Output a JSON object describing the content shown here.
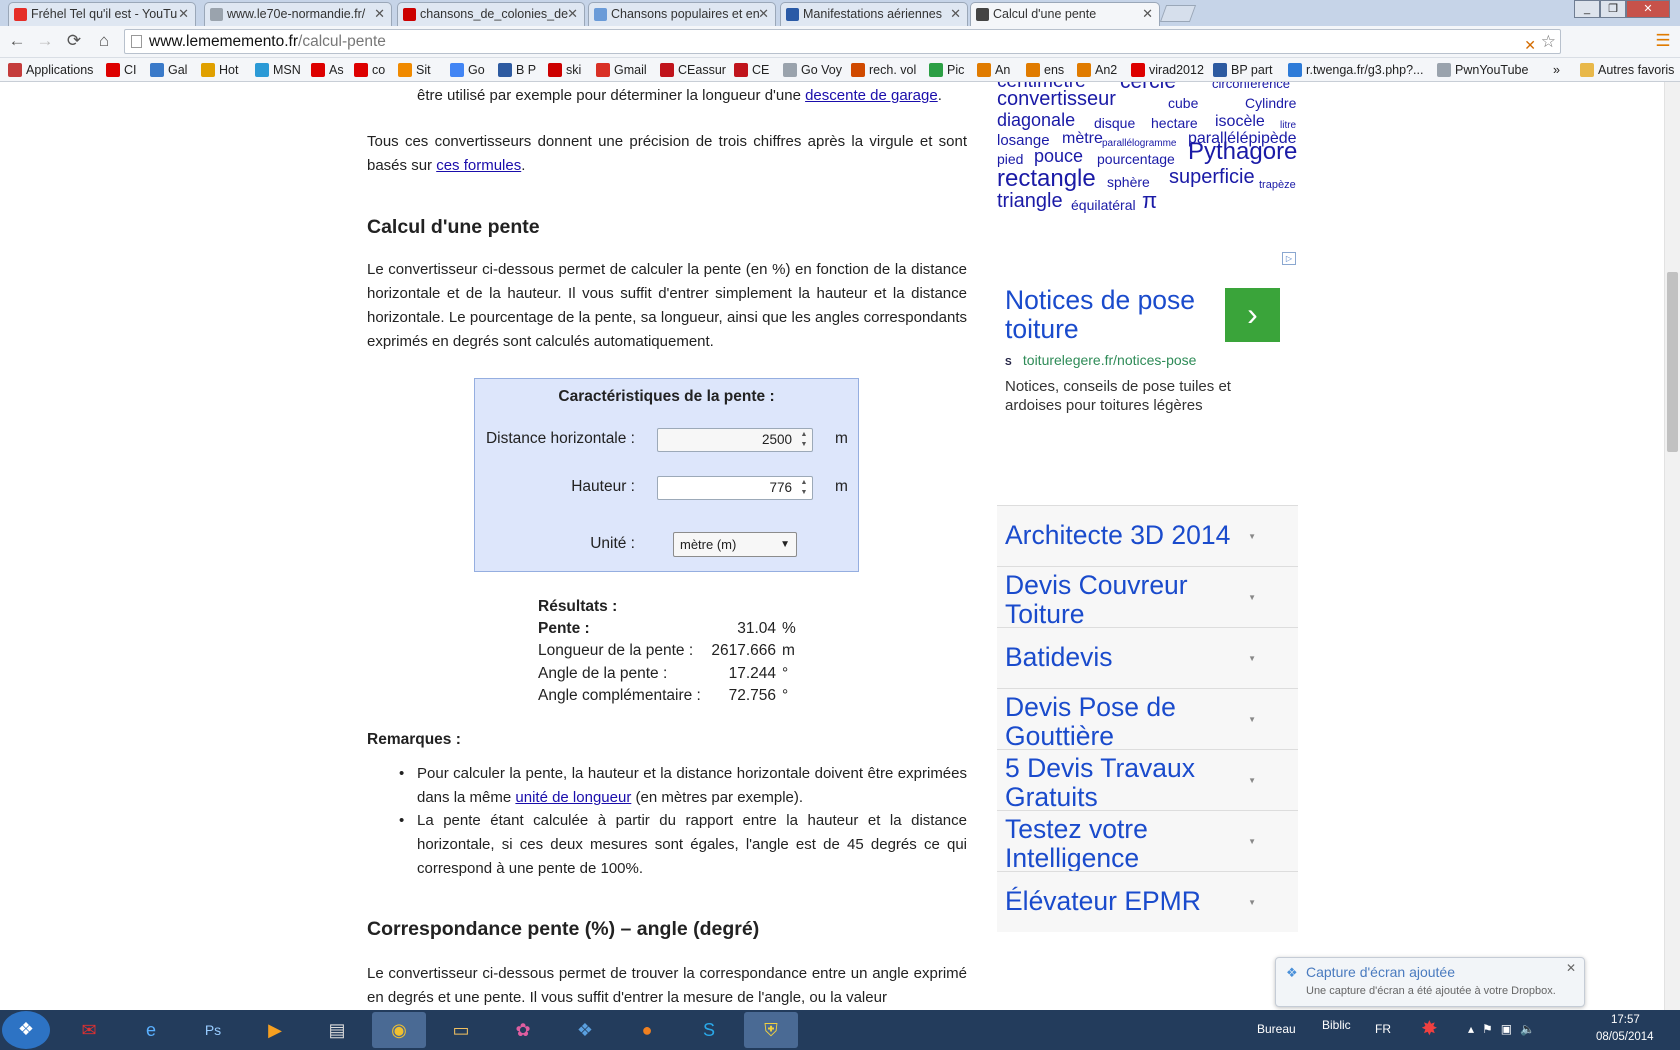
{
  "tabs": [
    {
      "icon": "youtube-icon",
      "label": "Fréhel Tel qu'il est - YouTu",
      "color": "#e52d27"
    },
    {
      "icon": "page-icon",
      "label": "www.le70e-normandie.fr/",
      "color": "#9aa3ad"
    },
    {
      "icon": "free-icon",
      "label": "chansons_de_colonies_de",
      "color": "#cc0000"
    },
    {
      "icon": "chat-icon",
      "label": "Chansons populaires et en",
      "color": "#6a9bd8"
    },
    {
      "icon": "plane-icon",
      "label": "Manifestations aériennes",
      "color": "#2a5aa6"
    },
    {
      "icon": "check-icon",
      "label": "Calcul d'une pente",
      "color": "#444"
    }
  ],
  "address": {
    "host": "www.lemememento.fr",
    "path": "/calcul-pente"
  },
  "bookmarks": [
    {
      "label": "Applications",
      "icon": "apps-icon",
      "color": "#c43c3c"
    },
    {
      "label": "CI",
      "icon": "sfr-icon",
      "color": "#d00"
    },
    {
      "label": "Gal",
      "icon": "gal-icon",
      "color": "#3a7ac9"
    },
    {
      "label": "Hot",
      "icon": "hot-icon",
      "color": "#e0a000"
    },
    {
      "label": "MSN",
      "icon": "msn-icon",
      "color": "#2b9ad6"
    },
    {
      "label": "As",
      "icon": "sfr-icon",
      "color": "#d00"
    },
    {
      "label": "co",
      "icon": "sfr-icon",
      "color": "#d00"
    },
    {
      "label": "Sit",
      "icon": "sit-icon",
      "color": "#f08a00"
    },
    {
      "label": "Go",
      "icon": "google-icon",
      "color": "#4285f4"
    },
    {
      "label": "B P",
      "icon": "bp-icon",
      "color": "#2d5aa0"
    },
    {
      "label": "ski",
      "icon": "free-icon",
      "color": "#cc0000"
    },
    {
      "label": "Gmail",
      "icon": "gmail-icon",
      "color": "#d93025"
    },
    {
      "label": "CEassur",
      "icon": "ce-icon",
      "color": "#c0141c"
    },
    {
      "label": "CE",
      "icon": "ce-icon",
      "color": "#c0141c"
    },
    {
      "label": "Go Voy",
      "icon": "page-icon",
      "color": "#9aa3ad"
    },
    {
      "label": "rech. vol",
      "icon": "vol-icon",
      "color": "#d04a00"
    },
    {
      "label": "Pic",
      "icon": "pic-icon",
      "color": "#2c9f45"
    },
    {
      "label": "An",
      "icon": "an-icon",
      "color": "#e07b00"
    },
    {
      "label": "ens",
      "icon": "an-icon",
      "color": "#e07b00"
    },
    {
      "label": "An2",
      "icon": "an-icon",
      "color": "#e07b00"
    },
    {
      "label": "virad2012",
      "icon": "sfr-icon",
      "color": "#d00"
    },
    {
      "label": "BP part",
      "icon": "bp-icon",
      "color": "#2d5aa0"
    },
    {
      "label": "r.twenga.fr/g3.php?...",
      "icon": "twenga-icon",
      "color": "#2d7bd8"
    },
    {
      "label": "PwnYouTube",
      "icon": "page-icon",
      "color": "#9aa3ad"
    }
  ],
  "bookmarks_more": "»",
  "bookmarks_other": "Autres favoris",
  "content": {
    "p0_text": "être utilisé par exemple pour déterminer la longueur d'une ",
    "p0_link": "descente de garage",
    "p1_text": "Tous ces convertisseurs donnent une précision de trois chiffres après la virgule et sont basés sur ",
    "p1_link": "ces formules",
    "h_pente": "Calcul d'une pente",
    "p2": "Le convertisseur ci-dessous permet de calculer la pente (en %) en fonction de la distance horizontale et de la hauteur. Il vous suffit d'entrer simplement la hauteur et la distance horizontale. Le pourcentage de la pente, sa longueur, ainsi que les angles correspondants exprimés en degrés sont calculés automatiquement.",
    "calc": {
      "title": "Caractéristiques de la pente :",
      "dist_label": "Distance horizontale :",
      "dist_value": "2500",
      "height_label": "Hauteur :",
      "height_value": "776",
      "unit_short": "m",
      "unit_label": "Unité :",
      "unit_value": "mètre (m)"
    },
    "results": {
      "title": "Résultats :",
      "rows": [
        {
          "label": "Pente :",
          "value": "31.04",
          "unit": "%"
        },
        {
          "label": "Longueur de la pente :",
          "value": "2617.666",
          "unit": "m"
        },
        {
          "label": "Angle de la pente :",
          "value": "17.244",
          "unit": "°"
        },
        {
          "label": "Angle complémentaire :",
          "value": "72.756",
          "unit": "°"
        }
      ]
    },
    "remarques_title": "Remarques :",
    "rem1_a": "Pour calculer la pente, la hauteur et la distance horizontale doivent être exprimées dans la même ",
    "rem1_link": "unité de longueur",
    "rem1_b": " (en mètres par exemple).",
    "rem2": "La pente étant calculée à partir du rapport entre la hauteur et la distance horizontale, si ces deux mesures sont égales, l'angle est de 45 degrés ce qui correspond à une pente de 100%.",
    "h_corr": "Correspondance pente (%) – angle (degré)",
    "p3": "Le convertisseur ci-dessous permet de trouver la correspondance entre un angle exprimé en degrés et une pente.  Il vous suffit d'entrer la mesure de l'angle, ou la valeur"
  },
  "tags": [
    {
      "t": "centimètre",
      "s": 19
    },
    {
      "t": "cercle",
      "s": 21
    },
    {
      "t": "circonférence",
      "s": 13
    },
    {
      "t": "convertisseur",
      "s": 20
    },
    {
      "t": "cube",
      "s": 14
    },
    {
      "t": "Cylindre",
      "s": 14
    },
    {
      "t": "diagonale",
      "s": 18
    },
    {
      "t": "disque",
      "s": 14
    },
    {
      "t": "hectare",
      "s": 14
    },
    {
      "t": "isocèle",
      "s": 16
    },
    {
      "t": "litre",
      "s": 10
    },
    {
      "t": "losange",
      "s": 15
    },
    {
      "t": "mètre",
      "s": 16
    },
    {
      "t": "parallélogramme",
      "s": 10
    },
    {
      "t": "parallélépipède",
      "s": 16
    },
    {
      "t": "pied",
      "s": 14
    },
    {
      "t": "pouce",
      "s": 18
    },
    {
      "t": "pourcentage",
      "s": 14
    },
    {
      "t": "Pythagore",
      "s": 24
    },
    {
      "t": "rectangle",
      "s": 24
    },
    {
      "t": "sphère",
      "s": 14
    },
    {
      "t": "superficie",
      "s": 20
    },
    {
      "t": "trapèze",
      "s": 11
    },
    {
      "t": "triangle",
      "s": 20
    },
    {
      "t": "équilatéral",
      "s": 14
    },
    {
      "t": "π",
      "s": 22
    }
  ],
  "ad": {
    "title": "Notices de pose toiture",
    "url": "toiturelegere.fr/notices-pose",
    "desc": "Notices, conseils de pose tuiles et ardoises pour toitures légères",
    "links": [
      "Architecte 3D 2014",
      "Devis Couvreur Toiture",
      "Batidevis",
      "Devis Pose de Gouttière",
      "5 Devis Travaux Gratuits",
      "Testez votre Intelligence",
      "Élévateur EPMR"
    ]
  },
  "notification": {
    "title": "Capture d'écran ajoutée",
    "body": "Une capture d'écran a été ajoutée à votre Dropbox."
  },
  "taskbar": {
    "bureau": "Bureau",
    "biblio": "Biblic",
    "lang": "FR",
    "time": "17:57",
    "date": "08/05/2014"
  }
}
